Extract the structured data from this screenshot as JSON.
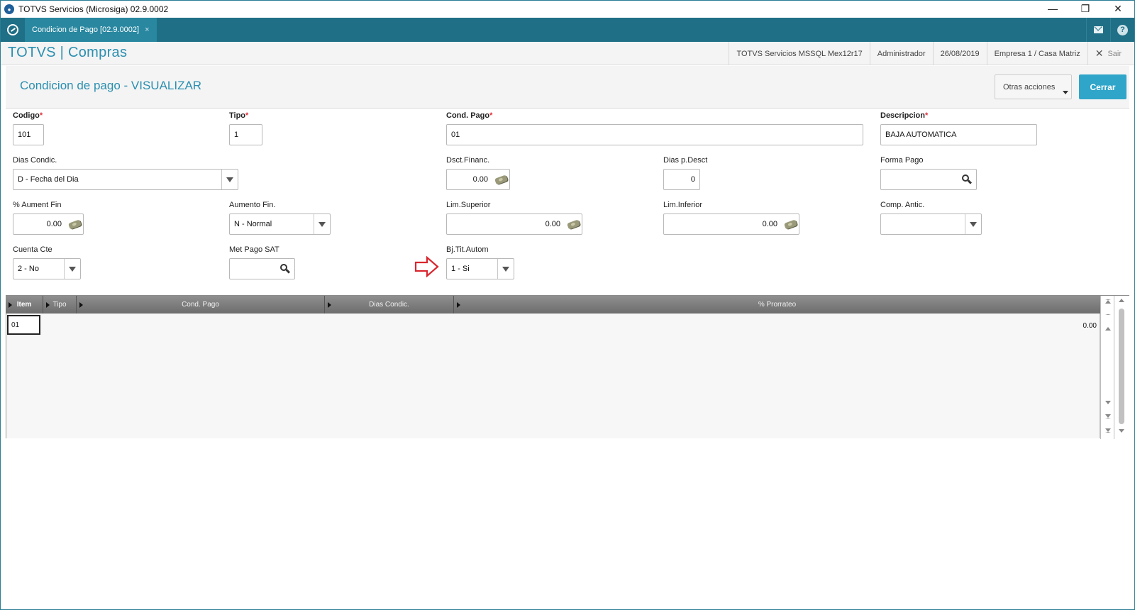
{
  "window": {
    "title": "TOTVS Servicios (Microsiga) 02.9.0002",
    "controls": {
      "minimize": "—",
      "restore": "❐",
      "close": "✕"
    }
  },
  "tabbar": {
    "active_tab": "Condicion de Pago [02.9.0002]",
    "tab_close": "×"
  },
  "module": {
    "title": "TOTVS | Compras",
    "environment": "TOTVS Servicios MSSQL Mex12r17",
    "user": "Administrador",
    "date": "26/08/2019",
    "company": "Empresa 1 / Casa Matriz",
    "exit_label": "Sair",
    "exit_icon": "✕"
  },
  "page": {
    "title": "Condicion de pago - VISUALIZAR",
    "otras_acciones": "Otras acciones",
    "cerrar": "Cerrar"
  },
  "form": {
    "codigo": {
      "label": "Codigo",
      "required": "*",
      "value": "101"
    },
    "tipo": {
      "label": "Tipo",
      "required": "*",
      "value": "1"
    },
    "cond_pago": {
      "label": "Cond. Pago",
      "required": "*",
      "value": "01"
    },
    "descripcion": {
      "label": "Descripcion",
      "required": "*",
      "value": "BAJA AUTOMATICA"
    },
    "dias_condic": {
      "label": "Dias Condic.",
      "value": "D - Fecha del Dia"
    },
    "dsct_financ": {
      "label": "Dsct.Financ.",
      "value": "0.00"
    },
    "dias_p_desct": {
      "label": "Dias p.Desct",
      "value": "0"
    },
    "forma_pago": {
      "label": "Forma Pago",
      "value": ""
    },
    "aument_fin": {
      "label": "% Aument Fin",
      "value": "0.00"
    },
    "aumento_fin": {
      "label": "Aumento Fin.",
      "value": "N - Normal"
    },
    "lim_superior": {
      "label": "Lim.Superior",
      "value": "0.00"
    },
    "lim_inferior": {
      "label": "Lim.Inferior",
      "value": "0.00"
    },
    "comp_antic": {
      "label": "Comp. Antic.",
      "value": ""
    },
    "cuenta_cte": {
      "label": "Cuenta Cte",
      "value": "2 - No"
    },
    "met_pago_sat": {
      "label": "Met Pago SAT",
      "value": ""
    },
    "bj_tit_autom": {
      "label": "Bj.Tit.Autom",
      "value": "1 - Si"
    }
  },
  "grid": {
    "columns": [
      "Item",
      "Tipo",
      "Cond. Pago",
      "Dias Condic.",
      "% Prorrateo"
    ],
    "rows": [
      {
        "item": "01",
        "tipo": "",
        "cond_pago": "",
        "dias_condic": "",
        "prorrateo": "0.00"
      }
    ]
  },
  "colors": {
    "accent": "#2b8fb0",
    "tabbar": "#1f6f86",
    "primary_button": "#2fa5c9",
    "required": "#e0303a",
    "annotation_arrow": "#d9262e"
  }
}
